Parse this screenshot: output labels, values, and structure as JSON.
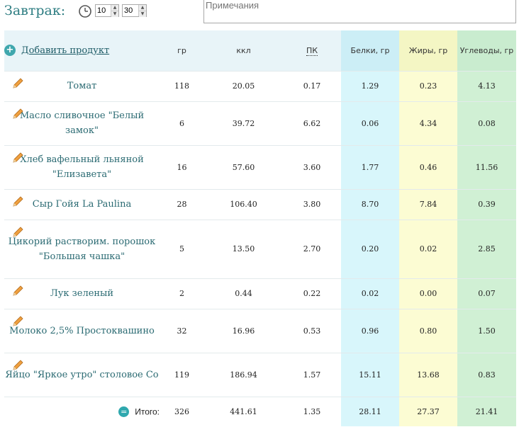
{
  "meal": {
    "title": "Завтрак:",
    "hours": "10",
    "minutes": "30",
    "notes_placeholder": "Примечания"
  },
  "table": {
    "add_product_label": "Добавить продукт",
    "headers": {
      "grams": "гр",
      "kcal": "ккл",
      "pk": "ПК",
      "protein": "Белки, гр",
      "fat": "Жиры, гр",
      "carbs": "Углеводы, гр"
    },
    "rows": [
      {
        "name": "Томат",
        "grams": "118",
        "kcal": "20.05",
        "pk": "0.17",
        "protein": "1.29",
        "fat": "0.23",
        "carbs": "4.13"
      },
      {
        "name": "Масло сливочное \"Белый замок\"",
        "grams": "6",
        "kcal": "39.72",
        "pk": "6.62",
        "protein": "0.06",
        "fat": "4.34",
        "carbs": "0.08"
      },
      {
        "name": "Хлеб вафельный льняной \"Елизавета\"",
        "grams": "16",
        "kcal": "57.60",
        "pk": "3.60",
        "protein": "1.77",
        "fat": "0.46",
        "carbs": "11.56"
      },
      {
        "name": "Сыр Гойя La Paulina",
        "grams": "28",
        "kcal": "106.40",
        "pk": "3.80",
        "protein": "8.70",
        "fat": "7.84",
        "carbs": "0.39"
      },
      {
        "name": "Цикорий растворим. порошок \"Большая чашка\"",
        "grams": "5",
        "kcal": "13.50",
        "pk": "2.70",
        "protein": "0.20",
        "fat": "0.02",
        "carbs": "2.85"
      },
      {
        "name": "Лук зеленый",
        "grams": "2",
        "kcal": "0.44",
        "pk": "0.22",
        "protein": "0.02",
        "fat": "0.00",
        "carbs": "0.07"
      },
      {
        "name": "Молоко 2,5% Простоквашино",
        "grams": "32",
        "kcal": "16.96",
        "pk": "0.53",
        "protein": "0.96",
        "fat": "0.80",
        "carbs": "1.50"
      },
      {
        "name": "Яйцо \"Яркое утро\" столовое Со",
        "grams": "119",
        "kcal": "186.94",
        "pk": "1.57",
        "protein": "15.11",
        "fat": "13.68",
        "carbs": "0.83"
      }
    ],
    "total": {
      "label": "Итого:",
      "grams": "326",
      "kcal": "441.61",
      "pk": "1.35",
      "protein": "28.11",
      "fat": "27.37",
      "carbs": "21.41"
    }
  },
  "colors": {
    "accent": "#2e7d82",
    "protein_bg": "#d8f6fb",
    "fat_bg": "#fcfcd3",
    "carbs_bg": "#d0f0d4"
  },
  "icons": [
    "clock-icon",
    "plus-icon",
    "pencil-icon",
    "equals-icon",
    "arrow-up-icon",
    "arrow-down-icon"
  ]
}
